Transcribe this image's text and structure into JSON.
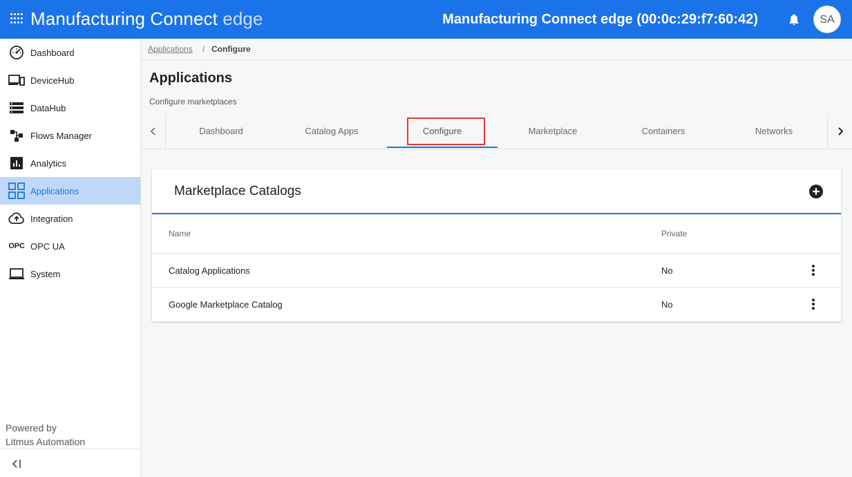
{
  "header": {
    "brand_main": "Manufacturing Connect",
    "brand_suffix": "edge",
    "device_title": "Manufacturing Connect edge (00:0c:29:f7:60:42)",
    "avatar_initials": "SA",
    "accent_color": "#1a73e8"
  },
  "sidebar": {
    "items": [
      {
        "label": "Dashboard",
        "icon": "speedometer-icon"
      },
      {
        "label": "DeviceHub",
        "icon": "devices-icon"
      },
      {
        "label": "DataHub",
        "icon": "storage-icon"
      },
      {
        "label": "Flows Manager",
        "icon": "flows-icon"
      },
      {
        "label": "Analytics",
        "icon": "analytics-icon"
      },
      {
        "label": "Applications",
        "icon": "apps-grid-icon",
        "active": true
      },
      {
        "label": "Integration",
        "icon": "cloud-upload-icon"
      },
      {
        "label": "OPC UA",
        "icon": "opc-icon",
        "icon_text": "OPC"
      },
      {
        "label": "System",
        "icon": "laptop-icon"
      }
    ],
    "powered_line1": "Powered by",
    "powered_line2": "Litmus Automation"
  },
  "breadcrumb": {
    "parent": "Applications",
    "separator": "/",
    "current": "Configure"
  },
  "page": {
    "title": "Applications",
    "subtitle": "Configure marketplaces"
  },
  "tabs": [
    {
      "label": "Dashboard"
    },
    {
      "label": "Catalog Apps"
    },
    {
      "label": "Configure",
      "active": true
    },
    {
      "label": "Marketplace"
    },
    {
      "label": "Containers"
    },
    {
      "label": "Networks"
    }
  ],
  "card": {
    "title": "Marketplace Catalogs",
    "columns": {
      "name": "Name",
      "private": "Private"
    },
    "rows": [
      {
        "name": "Catalog Applications",
        "private": "No"
      },
      {
        "name": "Google Marketplace Catalog",
        "private": "No"
      }
    ]
  }
}
